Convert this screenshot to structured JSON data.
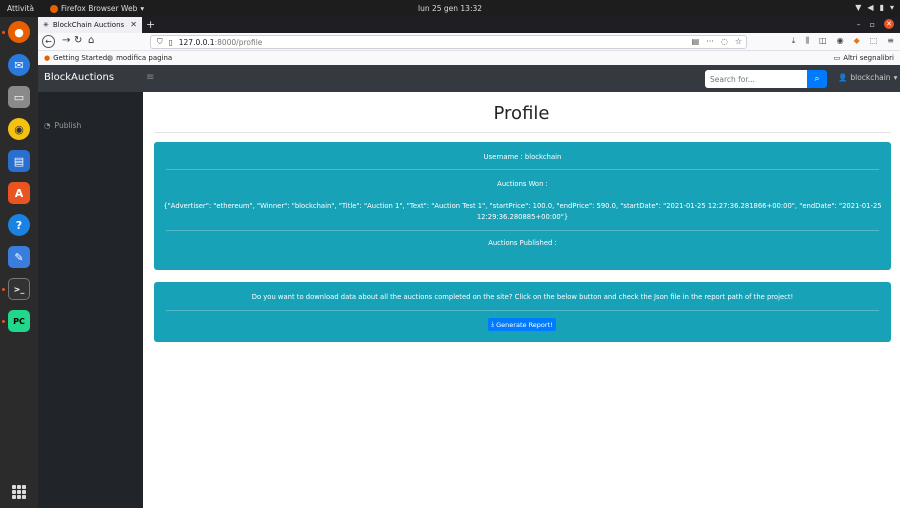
{
  "os": {
    "activities": "Attività",
    "app_name": "Firefox Browser Web",
    "clock": "lun 25 gen  13:32"
  },
  "browser": {
    "tab_title": "BlockChain Auctions",
    "url_host": "127.0.0.1",
    "url_path": ":8000/profile",
    "bookmarks": [
      {
        "label": "Getting Started"
      },
      {
        "label": "modifica pagina"
      }
    ],
    "other_bookmarks": "Altri segnalibri"
  },
  "site": {
    "brand": "BlockAuctions",
    "search": {
      "placeholder": "Search for..."
    },
    "user": "blockchain",
    "sidebar": {
      "publish": "Publish"
    }
  },
  "profile": {
    "title": "Profile",
    "username_line": "Username : blockchain",
    "won_heading": "Auctions Won :",
    "won_item_line1": "{\"Advertiser\": \"ethereum\", \"Winner\": \"blockchain\", \"Title\": \"Auction 1\", \"Text\": \"Auction Test 1\", \"startPrice\": 100.0, \"endPrice\": 590.0, \"startDate\": \"2021-01-25 12:27:36.281866+00:00\", \"endDate\": \"2021-01-25",
    "won_item_line2": "12:29:36.280885+00:00\"}",
    "published_heading": "Auctions Published :",
    "report_text": "Do you want to download data about all the auctions completed on the site? Click on the below button and check the Json file in the report path of the project!",
    "report_button": "Generate Report!"
  },
  "colors": {
    "card": "#17a2b8",
    "primary": "#007bff",
    "navbar": "#343a40",
    "sidebar": "#212529"
  }
}
